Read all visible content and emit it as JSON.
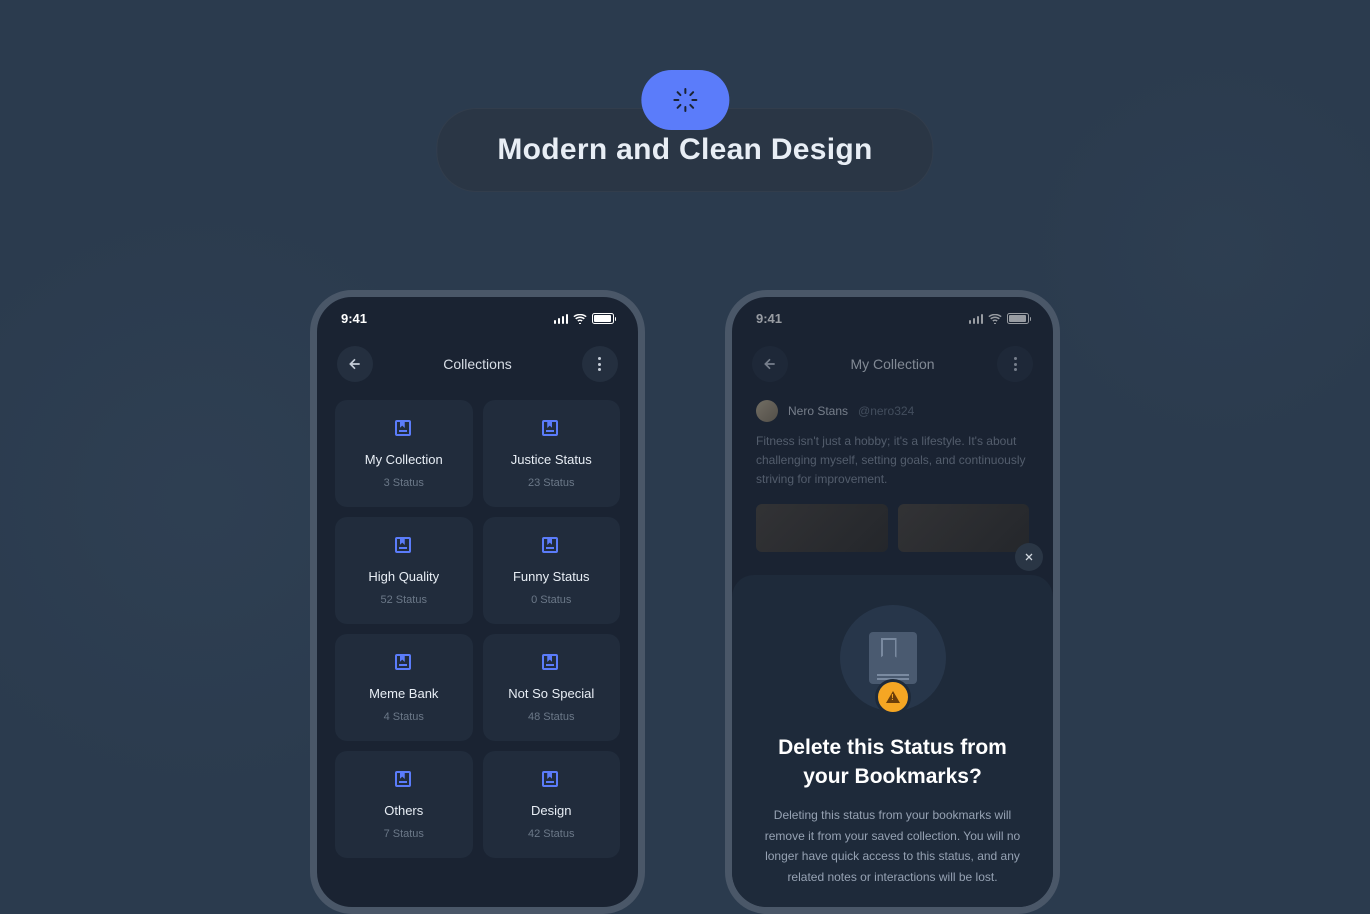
{
  "header": {
    "title": "Modern and Clean Design"
  },
  "phone1": {
    "time": "9:41",
    "nav_title": "Collections",
    "cards": [
      {
        "title": "My Collection",
        "sub": "3 Status"
      },
      {
        "title": "Justice Status",
        "sub": "23 Status"
      },
      {
        "title": "High Quality",
        "sub": "52 Status"
      },
      {
        "title": "Funny Status",
        "sub": "0 Status"
      },
      {
        "title": "Meme Bank",
        "sub": "4 Status"
      },
      {
        "title": "Not So Special",
        "sub": "48 Status"
      },
      {
        "title": "Others",
        "sub": "7 Status"
      },
      {
        "title": "Design",
        "sub": "42 Status"
      }
    ]
  },
  "phone2": {
    "time": "9:41",
    "nav_title": "My Collection",
    "post": {
      "name": "Nero Stans",
      "handle": "@nero324",
      "text": "Fitness isn't just a hobby; it's a lifestyle. It's about challenging myself, setting goals, and continuously striving for improvement."
    },
    "modal": {
      "title": "Delete this Status from your Bookmarks?",
      "desc": "Deleting this status from your bookmarks will remove it from your saved collection. You will no longer have quick access to this status, and any related notes or interactions will be lost."
    }
  }
}
